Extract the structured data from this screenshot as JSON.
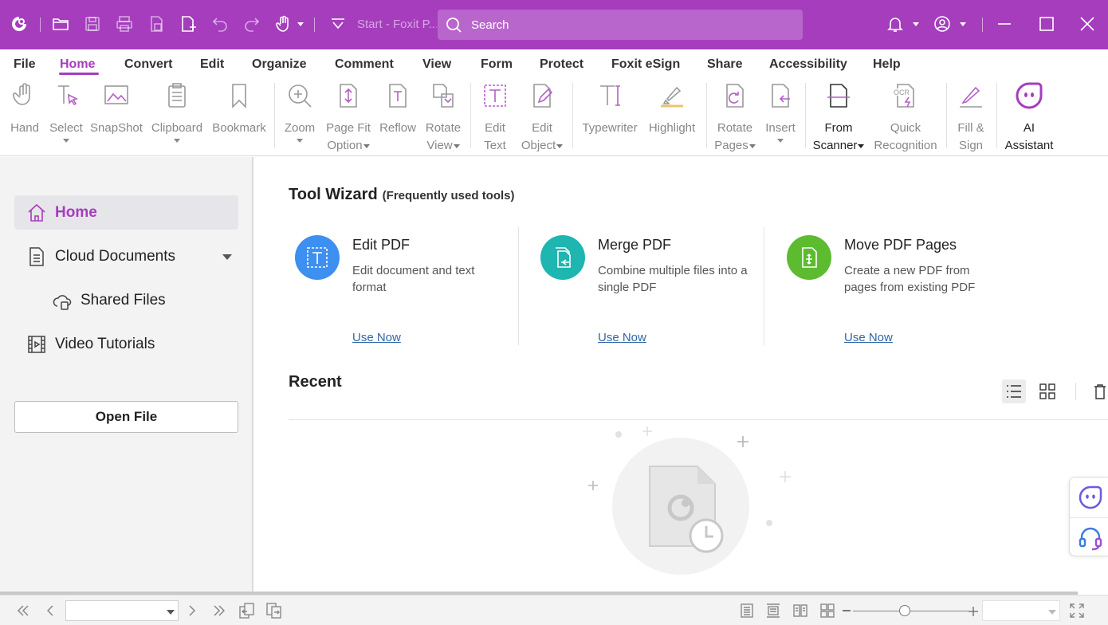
{
  "titlebar": {
    "doc_title": "Start - Foxit P...",
    "search_placeholder": "Search",
    "bg_color": "#a53dbd"
  },
  "menu": {
    "items": [
      "File",
      "Home",
      "Convert",
      "Edit",
      "Organize",
      "Comment",
      "View",
      "Form",
      "Protect",
      "Foxit eSign",
      "Share",
      "Accessibility",
      "Help"
    ],
    "active": "Home"
  },
  "ribbon": {
    "hand": "Hand",
    "select": "Select",
    "snapshot": "SnapShot",
    "clipboard": "Clipboard",
    "bookmark": "Bookmark",
    "zoom": "Zoom",
    "page_fit_1": "Page Fit",
    "page_fit_2": "Option",
    "reflow": "Reflow",
    "rotate_view_1": "Rotate",
    "rotate_view_2": "View",
    "edit_text_1": "Edit",
    "edit_text_2": "Text",
    "edit_object_1": "Edit",
    "edit_object_2": "Object",
    "typewriter": "Typewriter",
    "highlight": "Highlight",
    "rotate_pages_1": "Rotate",
    "rotate_pages_2": "Pages",
    "insert": "Insert",
    "from_scanner_1": "From",
    "from_scanner_2": "Scanner",
    "quick_recognition_1": "Quick",
    "quick_recognition_2": "Recognition",
    "fill_sign_1": "Fill &",
    "fill_sign_2": "Sign",
    "ai_assistant_1": "AI",
    "ai_assistant_2": "Assistant",
    "ocr_badge": "OCR"
  },
  "sidebar": {
    "home": "Home",
    "cloud_documents": "Cloud Documents",
    "shared_files": "Shared Files",
    "video_tutorials": "Video Tutorials",
    "open_file": "Open File"
  },
  "tool_wizard": {
    "title": "Tool Wizard",
    "subtitle": "(Frequently used tools)",
    "cards": [
      {
        "title": "Edit PDF",
        "desc": "Edit document and text format",
        "link": "Use Now",
        "color": "#3d8ff0"
      },
      {
        "title": "Merge PDF",
        "desc": "Combine multiple files into a single PDF",
        "link": "Use Now",
        "color": "#1fb5b0"
      },
      {
        "title": "Move PDF Pages",
        "desc": "Create a new PDF from pages from existing PDF",
        "link": "Use Now",
        "color": "#5dbb2f"
      }
    ]
  },
  "recent": {
    "title": "Recent",
    "view_mode": "list"
  },
  "statusbar": {
    "page_value": "",
    "zoom_value": "",
    "zoom_level": 0.45
  }
}
